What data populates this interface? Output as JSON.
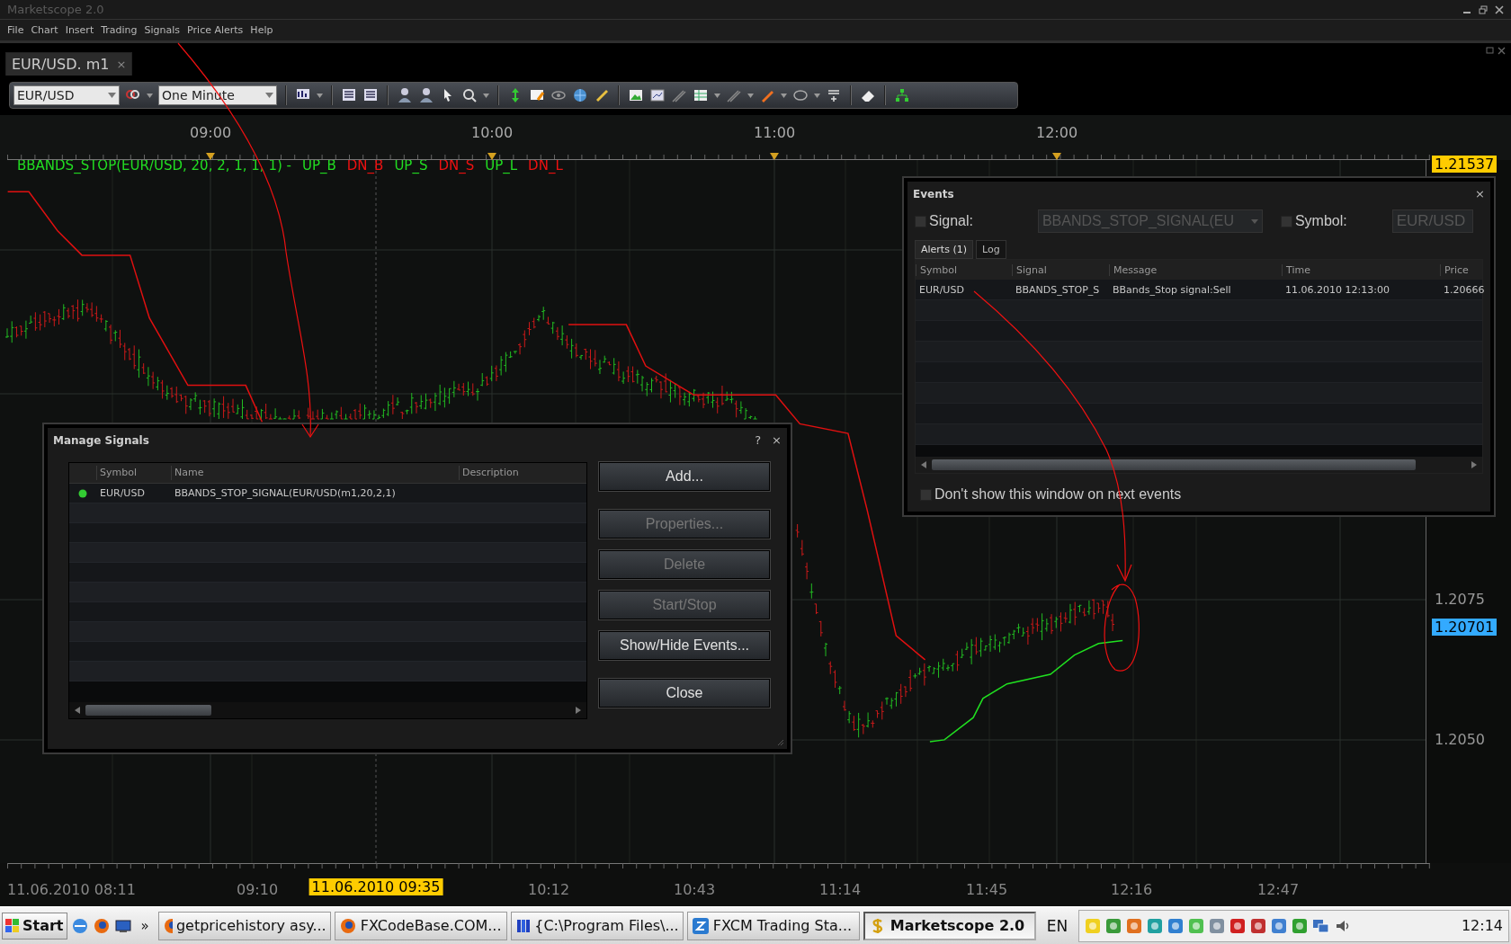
{
  "window": {
    "title": "Marketscope 2.0"
  },
  "menu": [
    "File",
    "Chart",
    "Insert",
    "Trading",
    "Signals",
    "Price Alerts",
    "Help"
  ],
  "tabs": [
    {
      "label": "EUR/USD. m1",
      "selected": true,
      "close": "×"
    }
  ],
  "toolbar": {
    "symbol": "EUR/USD",
    "timeframe": "One Minute"
  },
  "chart": {
    "top_axis": [
      "09:00",
      "10:00",
      "11:00",
      "12:00"
    ],
    "legend": [
      {
        "text": "BBANDS_STOP(EUR/USD, 20, 2, 1, 1, 1) -",
        "color": "#22dd22"
      },
      {
        "text": "UP_B",
        "color": "#22dd22"
      },
      {
        "text": "DN_B",
        "color": "#ee1111"
      },
      {
        "text": "UP_S",
        "color": "#22dd22"
      },
      {
        "text": "DN_S",
        "color": "#ee1111"
      },
      {
        "text": "UP_L",
        "color": "#22dd22"
      },
      {
        "text": "DN_L",
        "color": "#ee1111"
      }
    ],
    "price_labels": [
      {
        "text": "1.21537",
        "kind": "marker",
        "color": "#ffcc00"
      },
      {
        "text": "1.2075",
        "kind": "tick"
      },
      {
        "text": "1.20701",
        "kind": "marker",
        "color": "#33aaff"
      },
      {
        "text": "1.2050",
        "kind": "tick"
      }
    ],
    "time_labels": [
      {
        "text": "11.06.2010 08:11",
        "kind": "tick"
      },
      {
        "text": "09:10",
        "kind": "tick"
      },
      {
        "text": "11.06.2010 09:35",
        "kind": "marker"
      },
      {
        "text": "10:12",
        "kind": "tick"
      },
      {
        "text": "10:43",
        "kind": "tick"
      },
      {
        "text": "11:14",
        "kind": "tick"
      },
      {
        "text": "11:45",
        "kind": "tick"
      },
      {
        "text": "12:16",
        "kind": "tick"
      },
      {
        "text": "12:47",
        "kind": "tick"
      }
    ]
  },
  "manage_signals": {
    "title": "Manage Signals",
    "help": "?",
    "close": "×",
    "columns": [
      "Symbol",
      "Name",
      "Description"
    ],
    "rows": [
      {
        "active": true,
        "symbol": "EUR/USD",
        "name": "BBANDS_STOP_SIGNAL(EUR/USD(m1,20,2,1)"
      }
    ],
    "buttons": [
      {
        "label": "Add...",
        "disabled": false
      },
      {
        "label": "Properties...",
        "disabled": true
      },
      {
        "label": "Delete",
        "disabled": true
      },
      {
        "label": "Start/Stop",
        "disabled": true
      },
      {
        "label": "Show/Hide Events...",
        "disabled": false
      },
      {
        "label": "Close",
        "disabled": false
      }
    ]
  },
  "events": {
    "title": "Events",
    "close": "×",
    "signal_filter": {
      "label": "Signal:",
      "checked": false,
      "value": "BBANDS_STOP_SIGNAL(EU"
    },
    "symbol_filter": {
      "label": "Symbol:",
      "checked": false,
      "value": "EUR/USD"
    },
    "tabs": [
      {
        "label": "Alerts (1)",
        "selected": true
      },
      {
        "label": "Log",
        "selected": false
      }
    ],
    "columns": [
      "Symbol",
      "Signal",
      "Message",
      "Time",
      "Price"
    ],
    "rows": [
      {
        "symbol": "EUR/USD",
        "signal": "BBANDS_STOP_S",
        "message": "BBands_Stop signal:Sell",
        "time": "11.06.2010 12:13:00",
        "price": "1.20666"
      }
    ],
    "dont_show": {
      "label": "Don't show this window on next events",
      "checked": false
    }
  },
  "taskbar": {
    "start": "Start",
    "more": "»",
    "tasks": [
      {
        "label": "getpricehistory asy...",
        "selected": false,
        "kind": "browser"
      },
      {
        "label": "FXCodeBase.COM...",
        "selected": false,
        "kind": "browser"
      },
      {
        "label": "{C:\\Program Files\\...",
        "selected": false,
        "kind": "folder"
      },
      {
        "label": "FXCM Trading Sta...",
        "selected": false,
        "kind": "app"
      },
      {
        "label": "Marketscope 2.0",
        "selected": true,
        "kind": "dollar"
      }
    ],
    "language": "EN",
    "clock": "12:14"
  }
}
